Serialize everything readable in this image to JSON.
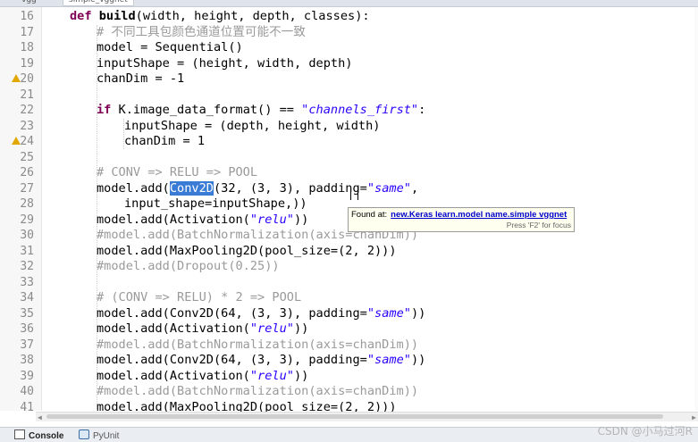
{
  "tabs": [
    {
      "label": "vgg"
    },
    {
      "label": "simple_vggnet"
    }
  ],
  "lines": [
    {
      "no": "16",
      "warn": false,
      "html": "<span class=\"kw\">def</span> <span class=\"fn\">build</span>(width, height, depth, classes):",
      "indent": 0,
      "prefix": ""
    },
    {
      "no": "17",
      "warn": false,
      "html": "<span class=\"cm\"># 不同工具包颜色通道位置可能不一致</span>",
      "indent": 1
    },
    {
      "no": "18",
      "warn": false,
      "html": "model = Sequential()",
      "indent": 1
    },
    {
      "no": "19",
      "warn": false,
      "html": "inputShape = (height, width, depth)",
      "indent": 1
    },
    {
      "no": "20",
      "warn": true,
      "html": "chanDim = -1",
      "indent": 1
    },
    {
      "no": "21",
      "warn": false,
      "html": "",
      "indent": 1
    },
    {
      "no": "22",
      "warn": false,
      "html": "<span class=\"kw\">if</span> K.image_data_format() == <span class=\"str\">\"channels_first\"</span>:",
      "indent": 1
    },
    {
      "no": "23",
      "warn": false,
      "html": "inputShape = (depth, height, width)",
      "indent": 2
    },
    {
      "no": "24",
      "warn": true,
      "html": "chanDim = 1",
      "indent": 2
    },
    {
      "no": "25",
      "warn": false,
      "html": "",
      "indent": 1
    },
    {
      "no": "26",
      "warn": false,
      "html": "<span class=\"cm\"># CONV => RELU => POOL</span>",
      "indent": 1
    },
    {
      "no": "27",
      "warn": false,
      "html": "model.add(<span class=\"sel\">Conv2D</span>(32, (3, 3), padding=<span class=\"str\">\"same\"</span>,",
      "indent": 1
    },
    {
      "no": "28",
      "warn": false,
      "html": "input_shape=inputShape,))",
      "indent": 2
    },
    {
      "no": "29",
      "warn": false,
      "html": "model.add(Activation(<span class=\"str\">\"relu\"</span>))",
      "indent": 1
    },
    {
      "no": "30",
      "warn": false,
      "html": "<span class=\"cm\">#model.add(BatchNormalization(axis=chanDim))</span>",
      "indent": 1
    },
    {
      "no": "31",
      "warn": false,
      "html": "model.add(MaxPooling2D(pool_size=(2, 2)))",
      "indent": 1
    },
    {
      "no": "32",
      "warn": false,
      "html": "<span class=\"cm\">#model.add(Dropout(0.25))</span>",
      "indent": 1
    },
    {
      "no": "33",
      "warn": false,
      "html": "",
      "indent": 1
    },
    {
      "no": "34",
      "warn": false,
      "html": "<span class=\"cm\"># (CONV => RELU) * 2 => POOL</span>",
      "indent": 1
    },
    {
      "no": "35",
      "warn": false,
      "html": "model.add(Conv2D(64, (3, 3), padding=<span class=\"str\">\"same\"</span>))",
      "indent": 1
    },
    {
      "no": "36",
      "warn": false,
      "html": "model.add(Activation(<span class=\"str\">\"relu\"</span>))",
      "indent": 1
    },
    {
      "no": "37",
      "warn": false,
      "html": "<span class=\"cm\">#model.add(BatchNormalization(axis=chanDim))</span>",
      "indent": 1
    },
    {
      "no": "38",
      "warn": false,
      "html": "model.add(Conv2D(64, (3, 3), padding=<span class=\"str\">\"same\"</span>))",
      "indent": 1
    },
    {
      "no": "39",
      "warn": false,
      "html": "model.add(Activation(<span class=\"str\">\"relu\"</span>))",
      "indent": 1
    },
    {
      "no": "40",
      "warn": false,
      "html": "<span class=\"cm\">#model.add(BatchNormalization(axis=chanDim))</span>",
      "indent": 1
    },
    {
      "no": "41",
      "warn": false,
      "html": "model.add(MaxPooling2D(pool_size=(2, 2)))",
      "indent": 1
    }
  ],
  "tooltip": {
    "prefix": "Found at:",
    "link": "new.Keras learn.model name.simple vggnet",
    "hint": "Press 'F2' for focus"
  },
  "bottom_tabs": [
    {
      "label": "Console"
    },
    {
      "label": "PyUnit"
    }
  ],
  "watermark": "CSDN @小马过河R"
}
